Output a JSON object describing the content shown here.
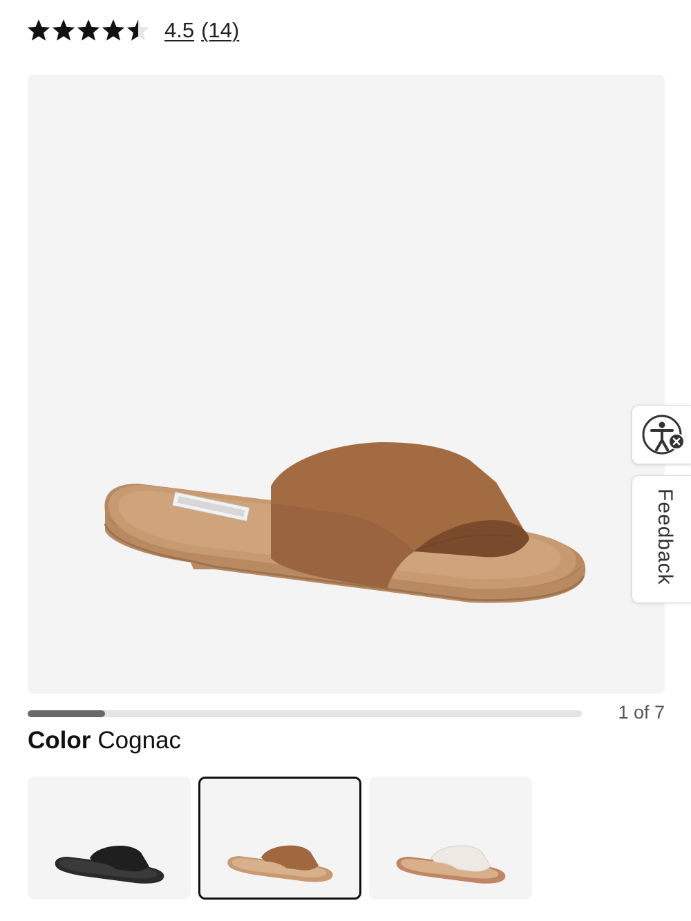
{
  "rating": {
    "value": 4.5,
    "out_of": 5,
    "score_text": "4.5",
    "count_text": "(14)"
  },
  "gallery": {
    "current": 1,
    "total": 7,
    "counter_text": "1 of 7",
    "progress_fraction": 0.14,
    "hero_alt": "Cognac slide sandal"
  },
  "color": {
    "label": "Color",
    "value": "Cognac"
  },
  "swatches": [
    {
      "name": "Black",
      "upper_color": "#1f1f1f",
      "sole_color": "#2a2a2a",
      "selected": false
    },
    {
      "name": "Cognac",
      "upper_color": "#a0683f",
      "sole_color": "#c79a72",
      "selected": true
    },
    {
      "name": "White",
      "upper_color": "#eeeae3",
      "sole_color": "#c08564",
      "selected": false
    }
  ],
  "side_widgets": {
    "accessibility_icon": "accessibility-icon",
    "feedback_label": "Feedback"
  },
  "colors": {
    "star": "#111111",
    "image_bg": "#f4f4f4",
    "progress_fill": "#6a6a6a",
    "progress_track": "#e4e4e4"
  }
}
